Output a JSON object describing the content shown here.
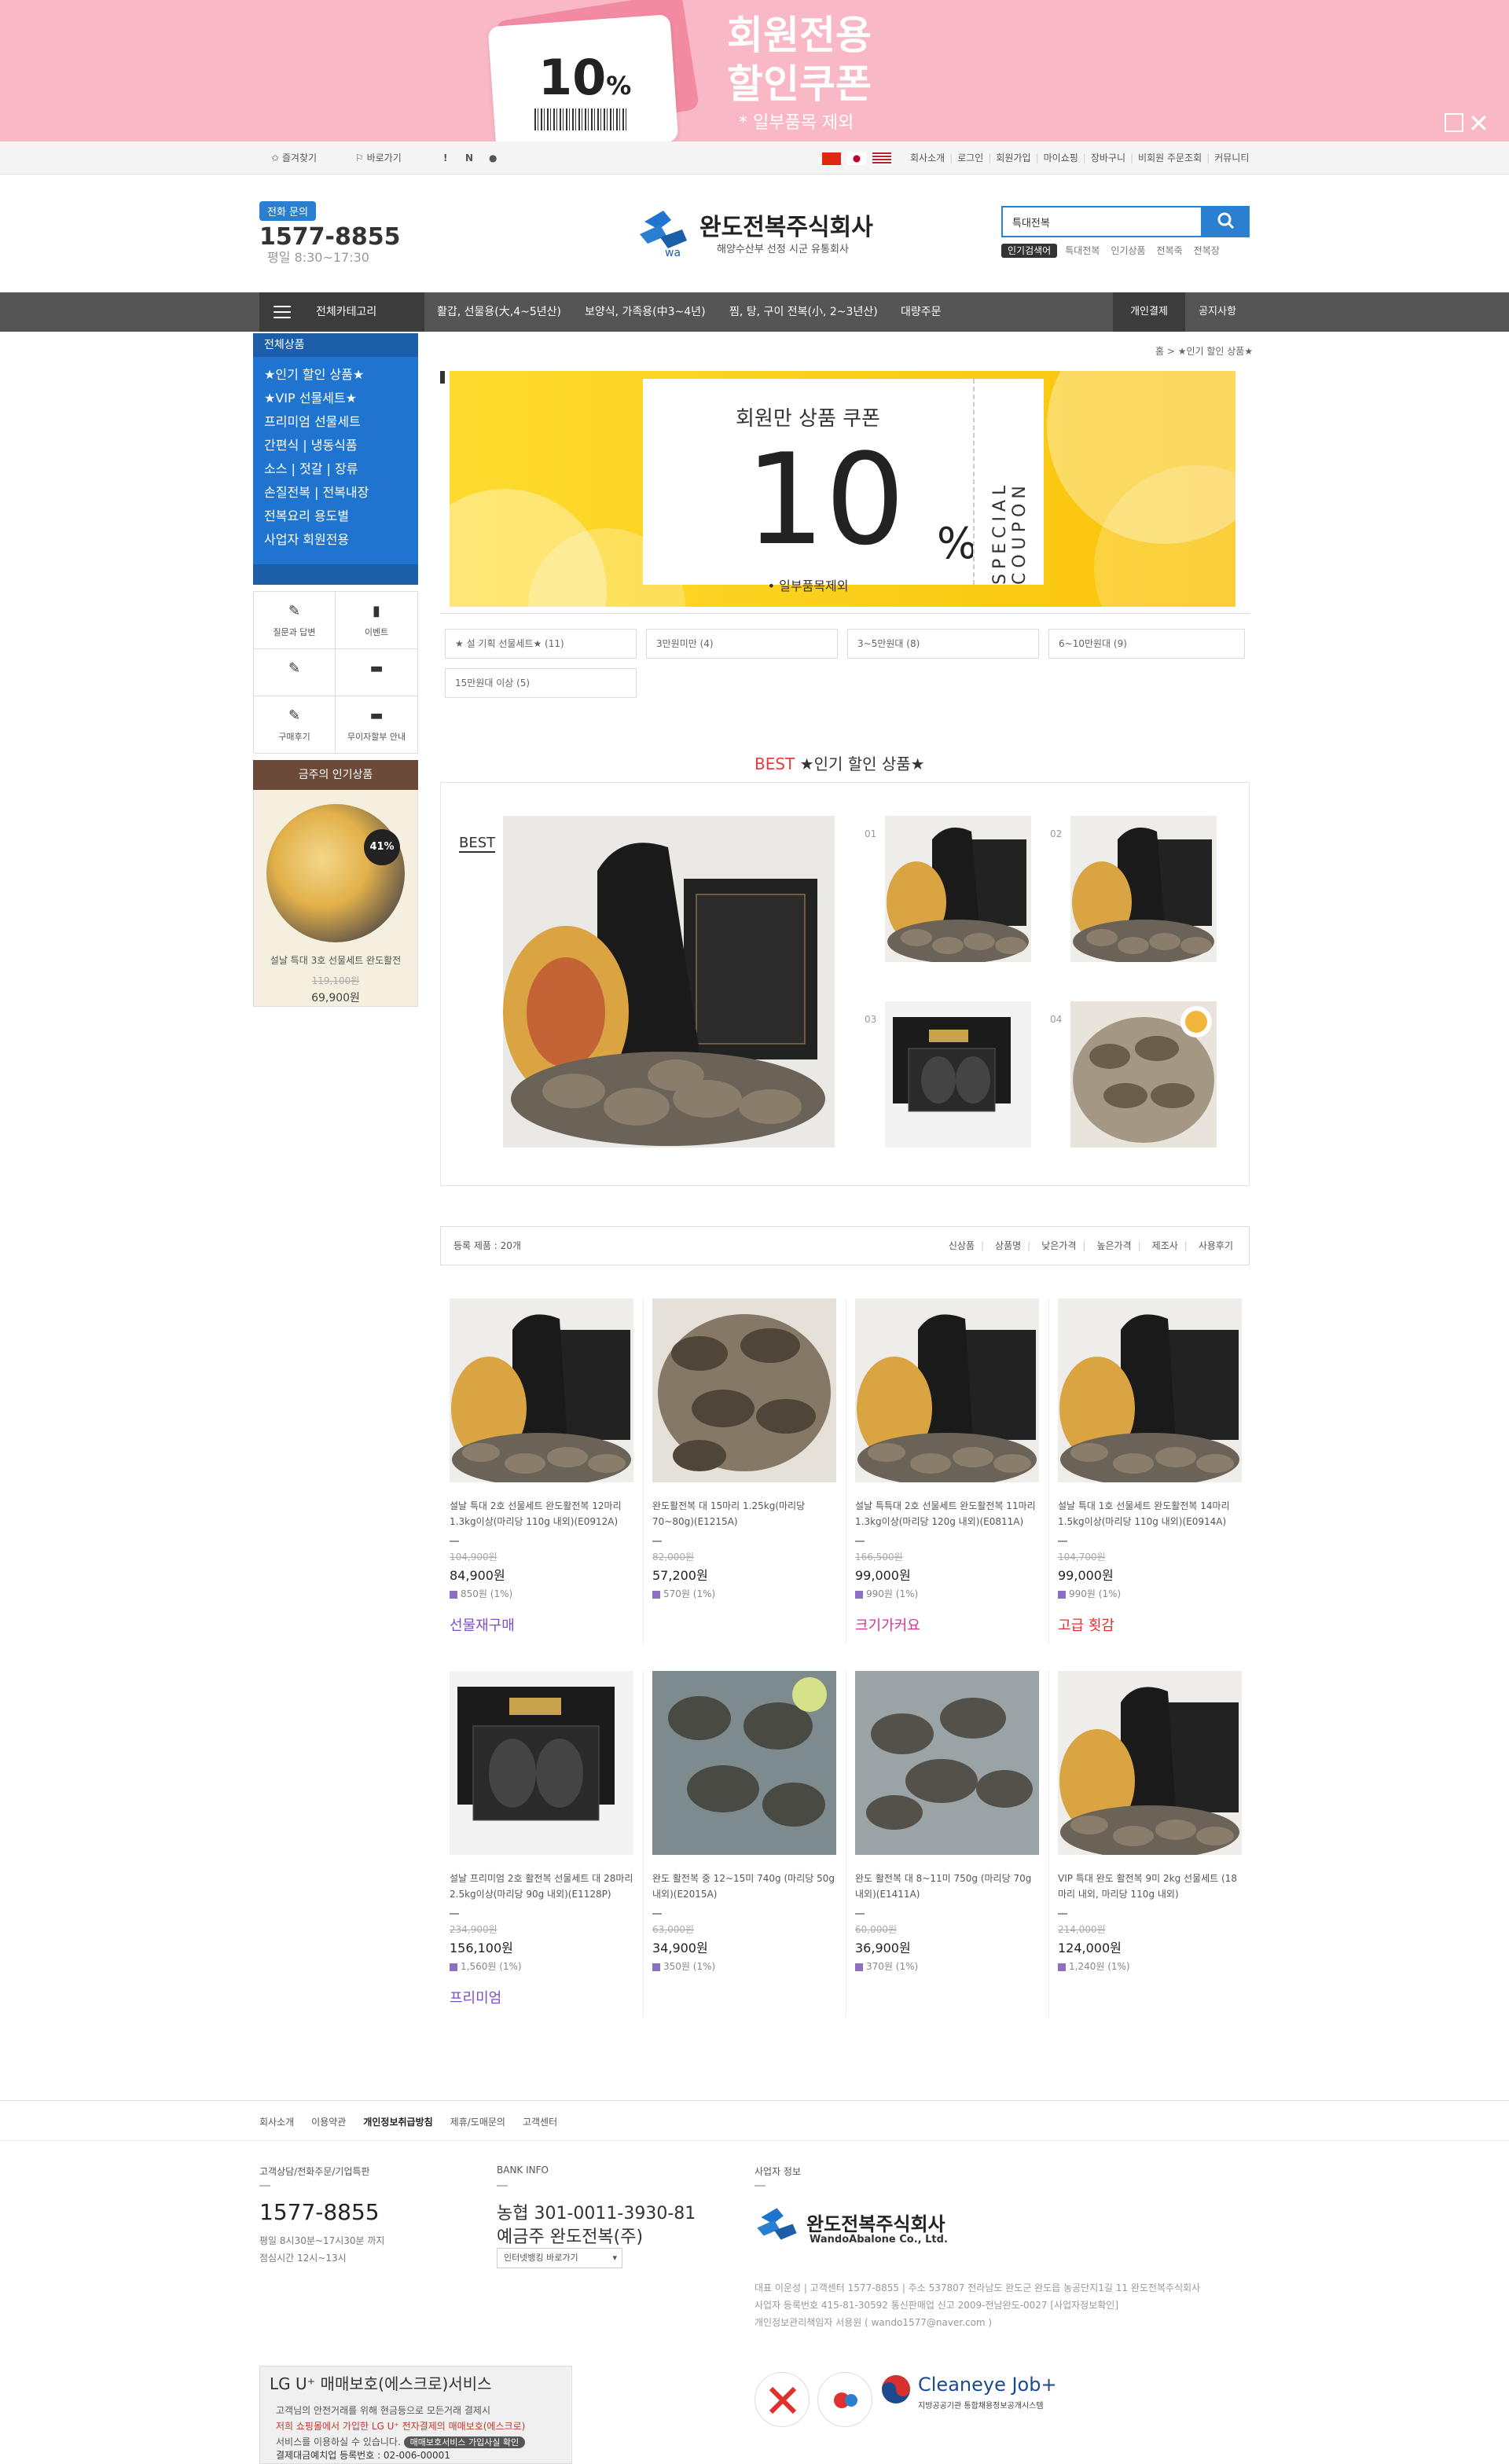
{
  "banner": {
    "coupon_pct": "10",
    "coupon_pct_sign": "%",
    "title_line1": "회원전용",
    "title_line2": "할인쿠폰",
    "note": "* 일부품목 제외"
  },
  "util": {
    "left": [
      "즐겨찾기",
      "바로가기"
    ],
    "left_icons": [
      "!",
      "N"
    ],
    "right": [
      "회사소개",
      "로그인",
      "회원가입",
      "마이쇼핑",
      "장바구니",
      "비회원 주문조회",
      "커뮤니티"
    ]
  },
  "header": {
    "phone_badge": "전화 문의",
    "phone": "1577-8855",
    "hours": "평일 8:30~17:30",
    "logo": "완도전복주식회사",
    "logo_sub": "해양수산부 선정 시군 유통회사",
    "search_value": "특대전복",
    "search_hot": "인기검색어",
    "search_tags": [
      "특대전복",
      "인기상품",
      "전복죽",
      "전복장"
    ]
  },
  "nav": {
    "category": "전체카테고리",
    "items": [
      "활갑, 선물용(大,4~5년산)",
      "보양식, 가족용(中3~4년)",
      "찜, 탕, 구이 전복(小, 2~3년산)",
      "대량주문"
    ],
    "right": [
      "개인결제",
      "공지사항"
    ]
  },
  "sidebar": {
    "head": "전체상품",
    "items": [
      "★인기 할인 상품★",
      "★VIP 선물세트★",
      "프리미엄 선물세트",
      "간편식 | 냉동식품",
      "소스 | 젓갈 | 장류",
      "손질전복 | 전복내장",
      "전복요리 용도별",
      "사업자 회원전용"
    ],
    "icons": [
      {
        "label": "질문과 답변",
        "glyph": "✎"
      },
      {
        "label": "이벤트",
        "glyph": "▮"
      },
      {
        "label": "",
        "glyph": "✎"
      },
      {
        "label": "",
        "glyph": "▬"
      },
      {
        "label": "구매후기",
        "glyph": "✎"
      },
      {
        "label": "무이자할부 안내",
        "glyph": "▬"
      }
    ],
    "popular_head": "금주의 인기상품",
    "popular_badge": "41%",
    "popular_name": "설날 특대 3호 선물세트 완도활전",
    "popular_old": "119,100원",
    "popular_price": "69,900원"
  },
  "main": {
    "breadcrumb": "홈  >  ★인기 할인 상품★",
    "coupon_title": "회원만 상품 쿠폰",
    "coupon_pct": "10",
    "coupon_pct_sign": "%",
    "coupon_note": "• 일부품목제외",
    "coupon_special": "SPECIAL COUPON",
    "filters": [
      "★ 설 기획 선물세트★ (11)",
      "3만원미만 (4)",
      "3~5만원대 (8)",
      "6~10만원대 (9)",
      "15만원대 이상 (5)"
    ],
    "best_prefix": "BEST",
    "best_title": "★인기 할인 상품★",
    "best_label": "BEST",
    "best_nums": [
      "01",
      "02",
      "03",
      "04"
    ],
    "list_count": "등록 제품 : 20개",
    "sort": [
      "신상품",
      "상품명",
      "낮은가격",
      "높은가격",
      "제조사",
      "사용후기"
    ]
  },
  "products": [
    {
      "name": "설날 특대 2호 선물세트 완도활전복 12마리 1.3kg이상(마리당 110g 내외)(E0912A)",
      "old": "104,900원",
      "price": "84,900원",
      "point": "850원 (1%)",
      "tag": "선물재구매",
      "tag_color": "#7a4fc9"
    },
    {
      "name": "완도활전복 대 15마리 1.25kg(마리당 70~80g)(E1215A)",
      "old": "82,000원",
      "price": "57,200원",
      "point": "570원 (1%)",
      "tag": "",
      "tag_color": ""
    },
    {
      "name": "설날 특특대 2호 선물세트 완도활전복 11마리 1.3kg이상(마리당 120g 내외)(E0811A)",
      "old": "166,500원",
      "price": "99,000원",
      "point": "990원 (1%)",
      "tag": "크기가커요",
      "tag_color": "#d6338a"
    },
    {
      "name": "설날 특대 1호 선물세트 완도활전복 14마리 1.5kg이상(마리당 110g 내외)(E0914A)",
      "old": "104,700원",
      "price": "99,000원",
      "point": "990원 (1%)",
      "tag": "고급 횟감",
      "tag_color": "#e0312f"
    },
    {
      "name": "설날 프리미엄 2호 활전복 선물세트 대 28마리 2.5kg이상(마리당 90g 내외)(E1128P)",
      "old": "234,900원",
      "price": "156,100원",
      "point": "1,560원 (1%)",
      "tag": "프리미엄",
      "tag_color": "#7a4fc9"
    },
    {
      "name": "완도 활전복 중 12~15미 740g (마리당 50g 내외)(E2015A)",
      "old": "63,000원",
      "price": "34,900원",
      "point": "350원 (1%)",
      "tag": "",
      "tag_color": ""
    },
    {
      "name": "완도 활전복 대 8~11미 750g (마리당 70g내외)(E1411A)",
      "old": "60,000원",
      "price": "36,900원",
      "point": "370원 (1%)",
      "tag": "",
      "tag_color": ""
    },
    {
      "name": "VIP 특대 완도 활전복 9미 2kg 선물세트 (18마리 내외, 마리당 110g 내외)",
      "old": "214,000원",
      "price": "124,000원",
      "point": "1,240원 (1%)",
      "tag": "",
      "tag_color": ""
    }
  ],
  "footer": {
    "links": [
      "회사소개",
      "이용약관",
      "개인정보취급방침",
      "제휴/도매문의",
      "고객센터"
    ],
    "cs_title": "고객상담/전화주문/기업특판",
    "cs_phone": "1577-8855",
    "cs_hours1": "평일 8시30분~17시30분 까지",
    "cs_hours2": "점심시간 12시~13시",
    "bank_title": "BANK INFO",
    "bank_line1": "농협    301-0011-3930-81",
    "bank_line2": "예금주   완도전복(주)",
    "bank_select": "인터넷뱅킹 바로가기",
    "biz_title": "사업자 정보",
    "logo": "완도전복주식회사",
    "logo_en": "WandoAbalone Co., Ltd.",
    "company1": "대표 이운성  |  고객센터 1577-8855  |  주소 537807 전라남도 완도군 완도읍 농공단지1길 11 완도전복주식회사",
    "company2": "사업자 등록번호 415-81-30592   통신판매업 신고 2009-전남완도-0027 [사업자정보확인]",
    "company3": "개인정보관리책임자 서용원 ( wando1577@naver.com )",
    "escrow_title": "LG U⁺ 매매보호(에스크로)서비스",
    "escrow_body1": "고객님의 안전거래를 위해 현금등으로 모든거래 결제시",
    "escrow_body2": "저희 쇼핑몰에서 가입한 LG U⁺ 전자결제의 매매보호(에스크로)",
    "escrow_body3": "서비스를 이용하실 수 있습니다.",
    "escrow_btn": "매매보호서비스 가입사실 확인",
    "escrow_reg": "결제대금예치업 등록번호 : 02-006-00001",
    "cleaneye_title": "Cleaneye Job+",
    "cleaneye_sub": "지방공공기관 통합채용정보공개시스템"
  }
}
